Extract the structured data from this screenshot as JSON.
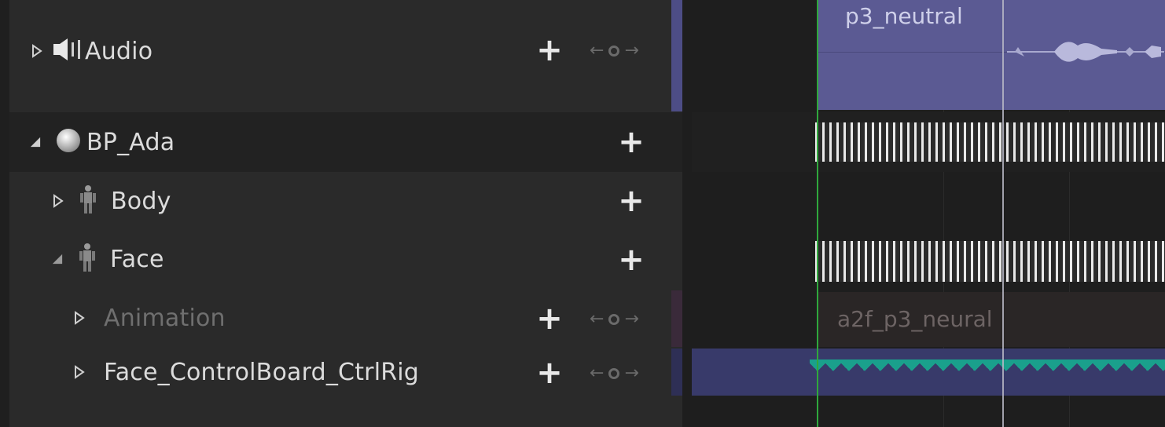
{
  "outliner": {
    "tracks": [
      {
        "id": "audio",
        "label": "Audio",
        "icon": "speaker-icon",
        "expanded": false,
        "dim": false
      },
      {
        "id": "bp_ada",
        "label": "BP_Ada",
        "icon": "sphere-icon",
        "expanded": true,
        "dim": false
      },
      {
        "id": "body",
        "label": "Body",
        "icon": "skeletal-mesh-icon",
        "expanded": false,
        "dim": false
      },
      {
        "id": "face",
        "label": "Face",
        "icon": "skeletal-mesh-icon",
        "expanded": true,
        "dim": false
      },
      {
        "id": "animation",
        "label": "Animation",
        "icon": "",
        "expanded": false,
        "dim": true
      },
      {
        "id": "face_ctrlrig",
        "label": "Face_ControlBoard_CtrlRig",
        "icon": "",
        "expanded": false,
        "dim": false
      }
    ],
    "add_glyph": "+",
    "keynav": {
      "prev": "←",
      "next": "→"
    }
  },
  "timeline": {
    "audio_section_title": "p3_neutral",
    "animation_section_title": "a2f_p3_neural"
  },
  "colors": {
    "audio_section": "#5b5a93",
    "ctrlrig_section": "#383a6a",
    "keyframe_tick": "#e9e9e9",
    "sawtooth": "#1aa08c",
    "start_marker": "#2fa83c"
  }
}
